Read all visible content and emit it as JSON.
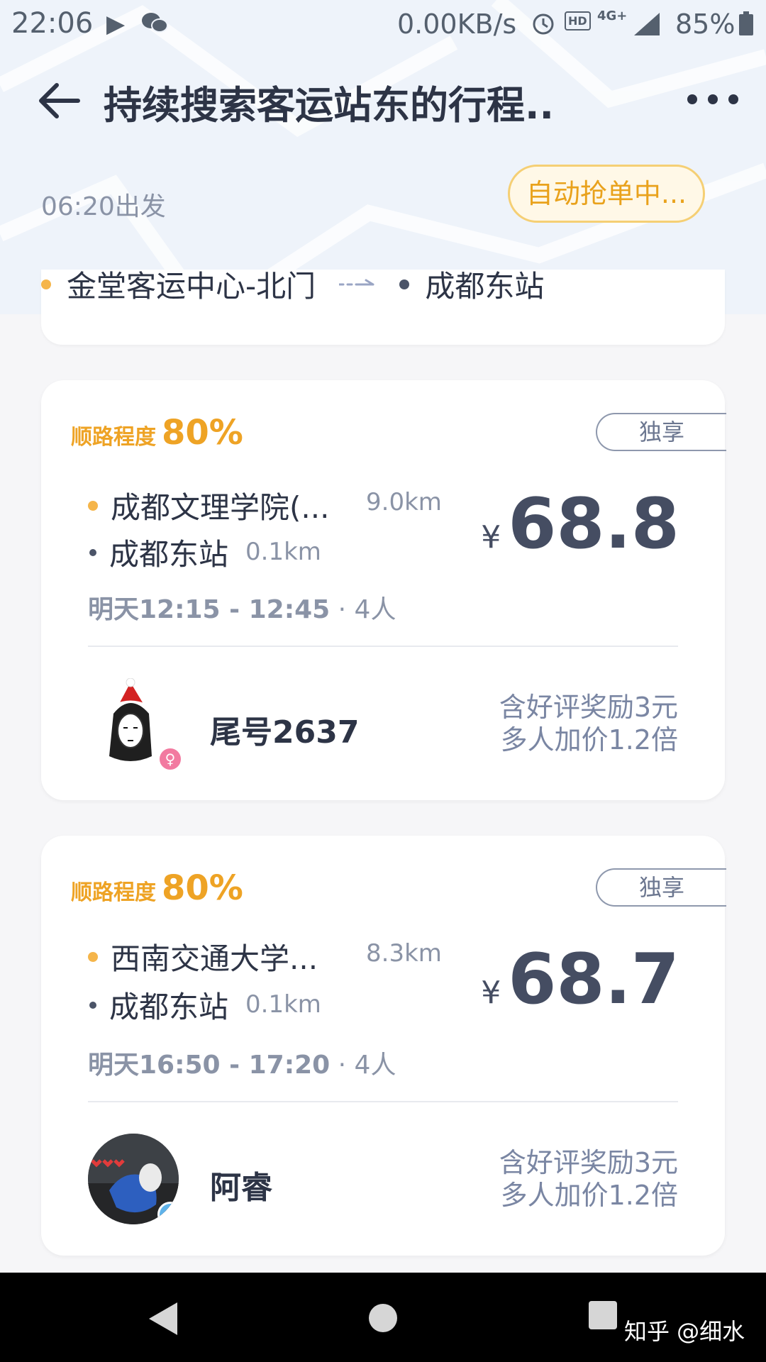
{
  "status_bar": {
    "time": "22:06",
    "network_speed": "0.00KB/s",
    "hd_label": "HD",
    "network_type": "4G+",
    "battery": "85%"
  },
  "header": {
    "title": "持续搜索客运站东的行程..",
    "departure": "06:20出发",
    "auto_grab_label": "自动抢单中...",
    "route_from": "金堂客运中心-北门",
    "route_to": "成都东站"
  },
  "cards": [
    {
      "match_label": "顺路程度",
      "match_pct": "80%",
      "tag": "独享",
      "pickup_name": "成都文理学院(...",
      "pickup_dist": "9.0km",
      "dropoff_name": "成都东站",
      "dropoff_dist": "0.1km",
      "currency": "¥",
      "price": "68.8",
      "time_range": "明天12:15 - 12:45",
      "passengers": "· 4人",
      "passenger_name": "尾号2637",
      "bonus_line1": "含好评奖励3元",
      "bonus_line2": "多人加价1.2倍",
      "gender": "female",
      "gender_color": "#f27aa0"
    },
    {
      "match_label": "顺路程度",
      "match_pct": "80%",
      "tag": "独享",
      "pickup_name": "西南交通大学...",
      "pickup_dist": "8.3km",
      "dropoff_name": "成都东站",
      "dropoff_dist": "0.1km",
      "currency": "¥",
      "price": "68.7",
      "time_range": "明天16:50 - 17:20",
      "passengers": "· 4人",
      "passenger_name": "阿睿",
      "bonus_line1": "含好评奖励3元",
      "bonus_line2": "多人加价1.2倍",
      "gender": "male",
      "gender_color": "#5fb3ea"
    }
  ],
  "watermark": "知乎 @细水",
  "colors": {
    "accent_orange": "#eea325",
    "origin_dot": "#f5b54a",
    "dest_dot": "#4b5468"
  }
}
